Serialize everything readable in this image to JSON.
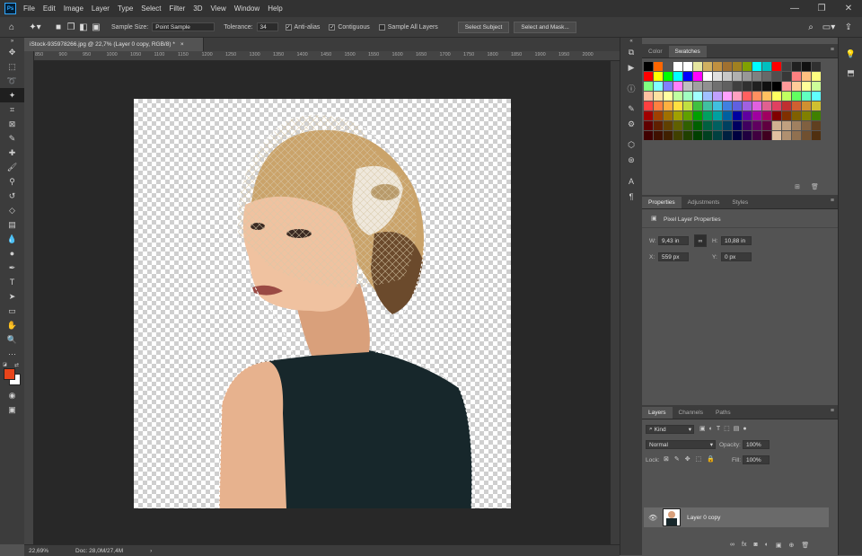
{
  "menu": {
    "logo": "Ps",
    "items": [
      "File",
      "Edit",
      "Image",
      "Layer",
      "Type",
      "Select",
      "Filter",
      "3D",
      "View",
      "Window",
      "Help"
    ],
    "window_controls": [
      "—",
      "❐",
      "✕"
    ]
  },
  "options": {
    "sample_size_label": "Sample Size:",
    "sample_size_value": "Point Sample",
    "tolerance_label": "Tolerance:",
    "tolerance_value": "34",
    "anti_alias": "Anti-alias",
    "contiguous": "Contiguous",
    "sample_all_layers": "Sample All Layers",
    "select_subject": "Select Subject",
    "select_and_mask": "Select and Mask..."
  },
  "document": {
    "tab_title": "iStock-935978266.jpg @ 22,7% (Layer 0 copy, RGB/8) *",
    "tab_close": "×",
    "ruler_marks": [
      "850",
      "900",
      "950",
      "1000",
      "1050",
      "1100",
      "1150",
      "1200",
      "1250",
      "1300",
      "1350",
      "1400",
      "1450",
      "1500",
      "1550",
      "1600",
      "1650",
      "1700",
      "1750",
      "1800",
      "1850",
      "1900",
      "1950",
      "2000"
    ],
    "zoom": "22,69%",
    "doc_size": "Doc: 28,0M/27,4M"
  },
  "color_panel": {
    "tabs": [
      "Color",
      "Swatches"
    ],
    "active_tab": "Swatches",
    "swatches": [
      "#000000",
      "#ff6600",
      "#555555",
      "#ffffff",
      "#ffffff",
      "#e6e6a0",
      "#d0b060",
      "#c09040",
      "#a07030",
      "#a08020",
      "#80a000",
      "#00ffff",
      "#00c0c0",
      "#ff0000",
      "#404040",
      "#202020",
      "#101010",
      "#303030",
      "#ff0000",
      "#ffff00",
      "#00ff00",
      "#00ffff",
      "#0000ff",
      "#ff00ff",
      "#ffffff",
      "#e0e0e0",
      "#c8c8c8",
      "#b0b0b0",
      "#989898",
      "#808080",
      "#686868",
      "#505050",
      "#383838",
      "#ff8080",
      "#ffc080",
      "#ffff80",
      "#80ff80",
      "#80ffff",
      "#8080ff",
      "#ff80ff",
      "#c0c0c0",
      "#a0a0a0",
      "#909090",
      "#707070",
      "#606060",
      "#404040",
      "#303030",
      "#202020",
      "#101010",
      "#000000",
      "#ff9999",
      "#ffcc99",
      "#ffff99",
      "#ccff99",
      "#ffc0a0",
      "#ffe0a0",
      "#ffffa0",
      "#c0ffa0",
      "#a0ffc0",
      "#a0ffff",
      "#a0c0ff",
      "#c0a0ff",
      "#ffa0ff",
      "#ffa0c0",
      "#ff6060",
      "#ff9060",
      "#ffc060",
      "#ffff60",
      "#c0ff60",
      "#60ff60",
      "#60ffc0",
      "#60ffff",
      "#ff4040",
      "#ff8040",
      "#ffb040",
      "#ffe040",
      "#c0e040",
      "#40c040",
      "#40c0a0",
      "#40c0e0",
      "#4080e0",
      "#6060e0",
      "#a060e0",
      "#e060e0",
      "#e06090",
      "#e04060",
      "#c03030",
      "#d06030",
      "#d09030",
      "#d0c030",
      "#a00000",
      "#a04000",
      "#a07000",
      "#a0a000",
      "#60a000",
      "#00a000",
      "#00a060",
      "#00a0a0",
      "#0060a0",
      "#0000a0",
      "#6000a0",
      "#a000a0",
      "#a00060",
      "#800000",
      "#803000",
      "#806000",
      "#808000",
      "#408000",
      "#600000",
      "#602000",
      "#604000",
      "#606000",
      "#306000",
      "#006000",
      "#006040",
      "#006060",
      "#004060",
      "#000060",
      "#400060",
      "#600060",
      "#600040",
      "#d0b090",
      "#c0a080",
      "#a08060",
      "#806040",
      "#604020",
      "#400000",
      "#401000",
      "#402000",
      "#404000",
      "#204000",
      "#004000",
      "#004020",
      "#004040",
      "#002040",
      "#000040",
      "#200040",
      "#400040",
      "#400020",
      "#e0c0a0",
      "#b09070",
      "#907050",
      "#705030",
      "#503010"
    ]
  },
  "properties": {
    "tabs": [
      "Properties",
      "Adjustments",
      "Styles"
    ],
    "title": "Pixel Layer Properties",
    "w_label": "W:",
    "w_value": "9,43 in",
    "link_icon": "∞",
    "h_label": "H:",
    "h_value": "10,88 in",
    "x_label": "X:",
    "x_value": "559 px",
    "y_label": "Y:",
    "y_value": "0 px"
  },
  "layers": {
    "tabs": [
      "Layers",
      "Channels",
      "Paths"
    ],
    "kind": "Kind",
    "blend_mode": "Normal",
    "opacity_label": "Opacity:",
    "opacity_value": "100%",
    "lock_label": "Lock:",
    "fill_label": "Fill:",
    "fill_value": "100%",
    "layer_name": "Layer 0 copy",
    "bottom_icons": [
      "∞",
      "fx",
      "◙",
      "◐",
      "▣",
      "⊕",
      "🗑"
    ]
  }
}
